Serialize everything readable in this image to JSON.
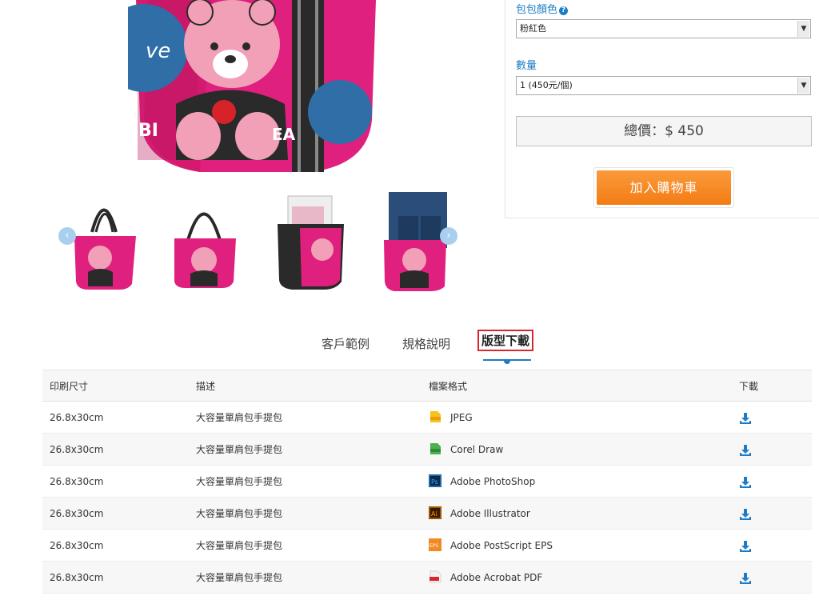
{
  "options": {
    "color_label": "包包顏色",
    "color_value": "粉紅色",
    "quantity_label": "數量",
    "quantity_value": "1 (450元/個)"
  },
  "total": "總價：$ 450",
  "cart_button": "加入購物車",
  "tabs": [
    "客戶範例",
    "規格說明",
    "版型下載"
  ],
  "table": {
    "headers": [
      "印刷尺寸",
      "描述",
      "檔案格式",
      "下載"
    ],
    "rows": [
      {
        "size": "26.8x30cm",
        "desc": "大容量單肩包手提包",
        "format": "JPEG",
        "icon": "jpeg-icon"
      },
      {
        "size": "26.8x30cm",
        "desc": "大容量單肩包手提包",
        "format": "Corel Draw",
        "icon": "cdr-icon"
      },
      {
        "size": "26.8x30cm",
        "desc": "大容量單肩包手提包",
        "format": "Adobe PhotoShop",
        "icon": "ps-icon"
      },
      {
        "size": "26.8x30cm",
        "desc": "大容量單肩包手提包",
        "format": "Adobe Illustrator",
        "icon": "ai-icon"
      },
      {
        "size": "26.8x30cm",
        "desc": "大容量單肩包手提包",
        "format": "Adobe PostScript EPS",
        "icon": "eps-icon"
      },
      {
        "size": "26.8x30cm",
        "desc": "大容量單肩包手提包",
        "format": "Adobe Acrobat PDF",
        "icon": "pdf-icon"
      }
    ]
  },
  "colors": {
    "accent": "#1d7dc4",
    "cart": "#f5841f",
    "tab_border": "#d9262c"
  }
}
